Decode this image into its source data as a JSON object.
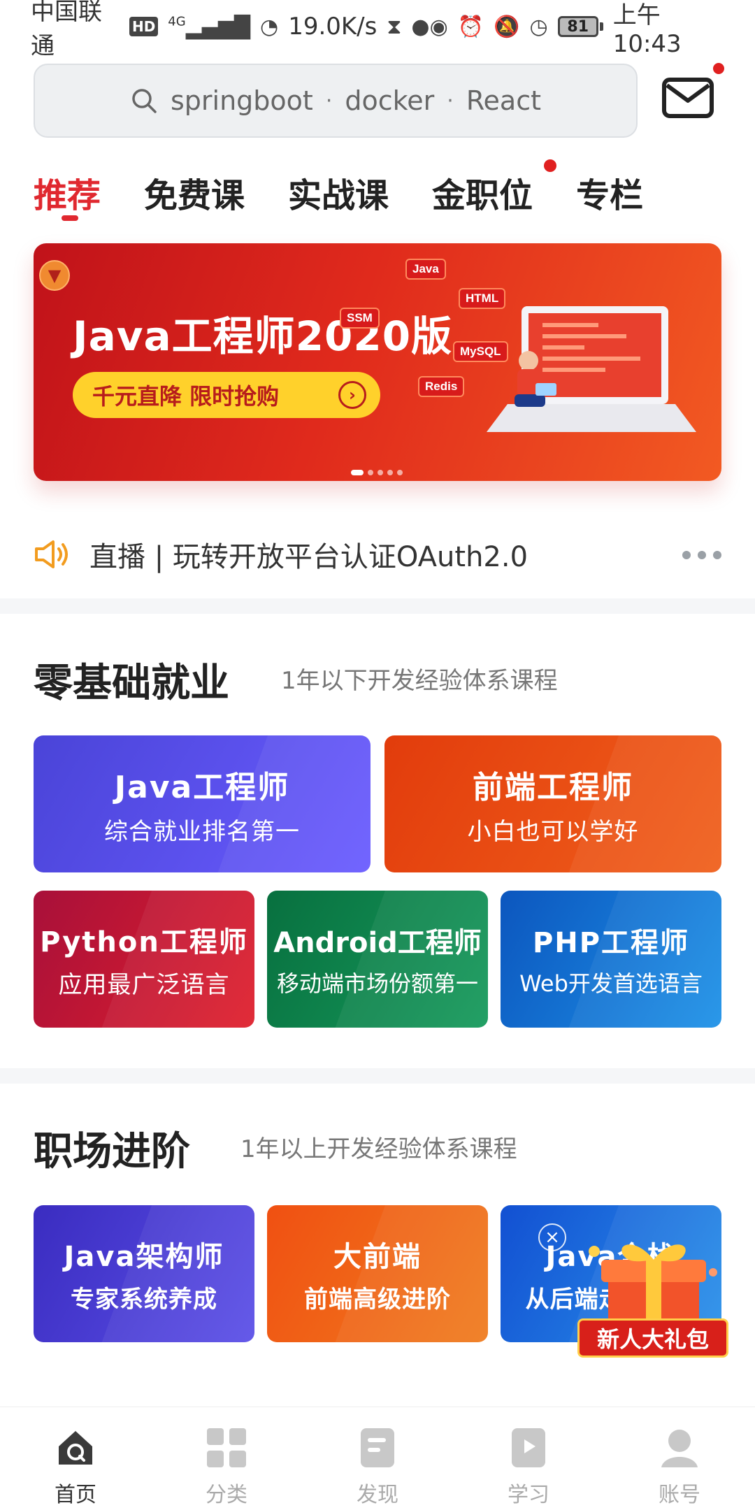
{
  "status_bar": {
    "carrier": "中国联通",
    "hd": "HD",
    "network": "4G",
    "speed": "19.0K/s",
    "battery": "81",
    "time": "上午10:43"
  },
  "search": {
    "keywords": [
      "springboot",
      "docker",
      "React"
    ]
  },
  "tabs": [
    {
      "label": "推荐",
      "active": true
    },
    {
      "label": "免费课"
    },
    {
      "label": "实战课"
    },
    {
      "label": "金职位",
      "badge_dot": true
    },
    {
      "label": "专栏"
    }
  ],
  "banner": {
    "title": "Java工程师2020版",
    "cta": "千元直降 限时抢购",
    "tags": [
      "Java",
      "HTML",
      "SSM",
      "MySQL",
      "Redis"
    ],
    "slide_count": 5,
    "active_slide": 1
  },
  "notice": {
    "text": "直播 | 玩转开放平台认证OAuth2.0"
  },
  "section1": {
    "title": "零基础就业",
    "subtitle": "1年以下开发经验体系课程",
    "cards": [
      {
        "title": "Java工程师",
        "subtitle": "综合就业排名第一",
        "colors": [
          "#4f46e5",
          "#6b5cff"
        ]
      },
      {
        "title": "前端工程师",
        "subtitle": "小白也可以学好",
        "colors": [
          "#e8420e",
          "#f0591a"
        ]
      },
      {
        "title": "Python工程师",
        "subtitle": "应用最广泛语言",
        "colors": [
          "#b5123c",
          "#e01f2c"
        ]
      },
      {
        "title": "Android工程师",
        "subtitle": "移动端市场份额第一",
        "colors": [
          "#0b7a4a",
          "#14975a"
        ]
      },
      {
        "title": "PHP工程师",
        "subtitle": "Web开发首选语言",
        "colors": [
          "#0f5fc4",
          "#1c8fe6"
        ]
      }
    ]
  },
  "section2": {
    "title": "职场进阶",
    "subtitle": "1年以上开发经验体系课程",
    "cards": [
      {
        "title": "Java架构师",
        "subtitle": "专家系统养成",
        "colors": [
          "#3f32c8",
          "#5b4ee6"
        ]
      },
      {
        "title": "大前端",
        "subtitle": "前端高级进阶",
        "colors": [
          "#f15a14",
          "#f07a1c"
        ]
      },
      {
        "title": "Java全栈",
        "subtitle": "从后端走向全栈",
        "colors": [
          "#1456d6",
          "#2c8ee8"
        ]
      }
    ]
  },
  "gift": {
    "label": "新人大礼包"
  },
  "bottom_nav": [
    {
      "label": "首页",
      "icon": "home-icon",
      "active": true
    },
    {
      "label": "分类",
      "icon": "category-icon"
    },
    {
      "label": "发现",
      "icon": "discover-icon"
    },
    {
      "label": "学习",
      "icon": "study-icon"
    },
    {
      "label": "账号",
      "icon": "account-icon"
    }
  ]
}
